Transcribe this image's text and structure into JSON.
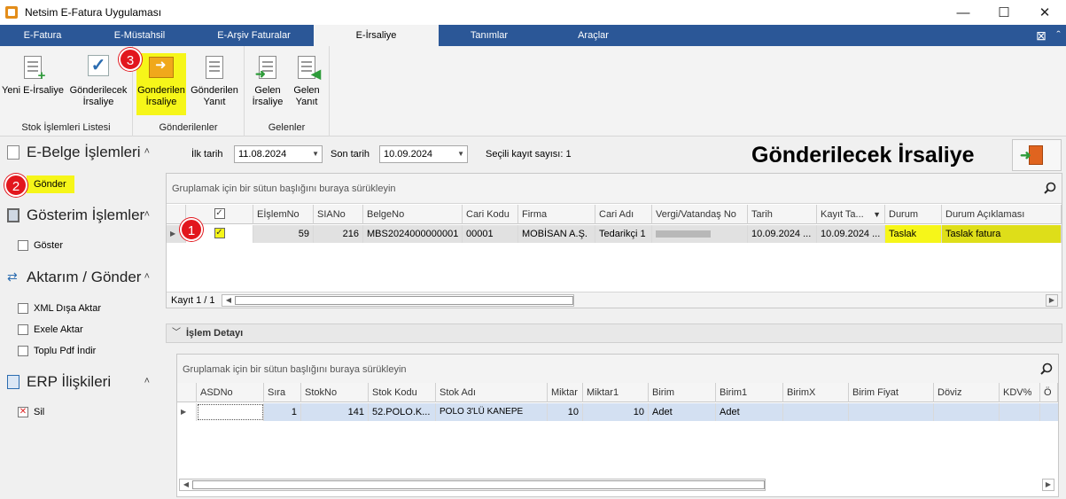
{
  "window": {
    "title": "Netsim E-Fatura Uygulaması",
    "minimize": "—",
    "maximize": "☐",
    "close": "✕"
  },
  "menu": {
    "tabs": [
      "E-Fatura",
      "E-Müstahsil",
      "E-Arşiv Faturalar",
      "E-İrsaliye",
      "Tanımlar",
      "Araçlar"
    ],
    "active": "E-İrsaliye",
    "close_icon": "⊠",
    "collapse_icon": "ˆ"
  },
  "ribbon": {
    "groups": [
      {
        "label": "Stok İşlemleri Listesi",
        "buttons": [
          {
            "label1": "Yeni E-İrsaliye",
            "label2": ""
          },
          {
            "label1": "Gönderilecek",
            "label2": "İrsaliye"
          }
        ]
      },
      {
        "label": "Gönderilenler",
        "buttons": [
          {
            "label1": "Gonderilen",
            "label2": "İrsaliye"
          },
          {
            "label1": "Gönderilen",
            "label2": "Yanıt"
          }
        ]
      },
      {
        "label": "Gelenler",
        "buttons": [
          {
            "label1": "Gelen",
            "label2": "İrsaliye"
          },
          {
            "label1": "Gelen",
            "label2": "Yanıt"
          }
        ]
      }
    ]
  },
  "sidebar": {
    "sections": [
      {
        "title": "E-Belge İşlemleri",
        "items": [
          "Gönder"
        ]
      },
      {
        "title": "Gösterim İşlemler",
        "items": [
          "Göster"
        ]
      },
      {
        "title": "Aktarım / Gönder",
        "items": [
          "XML Dışa Aktar",
          "Exele Aktar",
          "Toplu Pdf İndir"
        ]
      },
      {
        "title": "ERP İlişkileri",
        "items": [
          "Sil"
        ]
      }
    ],
    "caret": "˄"
  },
  "filters": {
    "start_label": "İlk tarih",
    "start_value": "11.08.2024",
    "end_label": "Son tarih",
    "end_value": "10.09.2024",
    "selected_label": "Seçili kayıt sayısı: 1"
  },
  "page_title": "Gönderilecek İrsaliye",
  "grid1": {
    "group_hint": "Gruplamak için bir sütun başlığını buraya sürükleyin",
    "columns": [
      "",
      "",
      "EİşlemNo",
      "SIANo",
      "BelgeNo",
      "Cari Kodu",
      "Firma",
      "Cari Adı",
      "Vergi/Vatandaş No",
      "Tarih",
      "Kayıt Ta...",
      "Durum",
      "Durum Açıklaması"
    ],
    "row": {
      "checked": "✓",
      "eislemno": "59",
      "siano": "216",
      "belgeno": "MBS2024000000001",
      "cari_kodu": "00001",
      "firma": "MOBİSAN A.Ş.",
      "cari_adi": "Tedarikçi 1",
      "vergi": "",
      "tarih": "10.09.2024 ...",
      "kayit": "10.09.2024 ...",
      "durum": "Taslak",
      "aciklama": "Taslak fatura"
    },
    "footer": "Kayıt 1 / 1"
  },
  "detail": {
    "title": "İşlem Detayı"
  },
  "grid2": {
    "group_hint": "Gruplamak için bir sütun başlığını buraya sürükleyin",
    "columns": [
      "",
      "ASDNo",
      "Sıra",
      "StokNo",
      "Stok Kodu",
      "Stok Adı",
      "Miktar",
      "Miktar1",
      "Birim",
      "Birim1",
      "BirimX",
      "Birim Fiyat",
      "Döviz",
      "KDV%",
      "Ö"
    ],
    "row": {
      "asdno": "",
      "sira": "1",
      "stokno": "141",
      "stok_kodu": "52.POLO.K...",
      "stok_adi": "POLO 3'LÜ KANEPE",
      "miktar": "10",
      "miktar1": "10",
      "birim": "Adet",
      "birim1": "Adet"
    }
  },
  "badges": [
    "1",
    "2",
    "3"
  ]
}
